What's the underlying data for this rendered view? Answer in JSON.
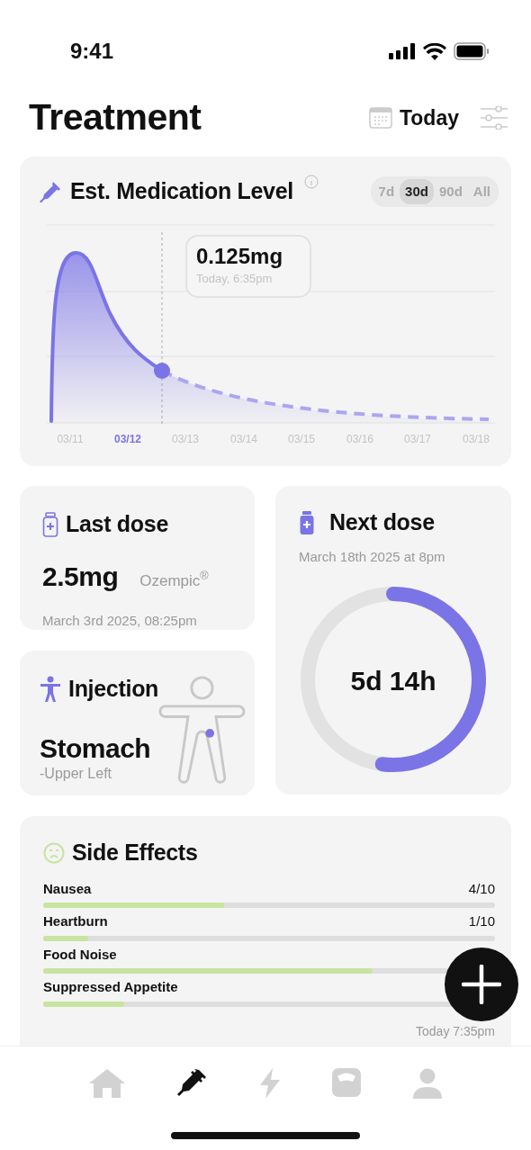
{
  "status_bar": {
    "time": "9:41"
  },
  "header": {
    "title": "Treatment",
    "date_button": "Today"
  },
  "medication_level": {
    "title": "Est. Medication Level",
    "ranges": [
      {
        "label": "7d",
        "selected": false
      },
      {
        "label": "30d",
        "selected": true
      },
      {
        "label": "90d",
        "selected": false
      },
      {
        "label": "All",
        "selected": false
      }
    ],
    "tooltip": {
      "value": "0.125mg",
      "time": "Today, 6:35pm"
    },
    "dates": [
      {
        "label": "03/11",
        "selected": false
      },
      {
        "label": "03/12",
        "selected": true
      },
      {
        "label": "03/13",
        "selected": false
      },
      {
        "label": "03/14",
        "selected": false
      },
      {
        "label": "03/15",
        "selected": false
      },
      {
        "label": "03/16",
        "selected": false
      },
      {
        "label": "03/17",
        "selected": false
      },
      {
        "label": "03/18",
        "selected": false
      }
    ]
  },
  "last_dose": {
    "title": "Last dose",
    "amount": "2.5mg",
    "brand": "Ozempic$^{®}$",
    "time": "March 3rd 2025, 08:25pm"
  },
  "next_dose": {
    "title": "Next dose",
    "time": "March 18th 2025 at 8pm",
    "countdown": "5d 14h",
    "level": 0.52
  },
  "injection": {
    "title": "Injection",
    "site": "Stomach",
    "detail": "-Upper Left"
  },
  "side_effects": {
    "title": "Side Effects",
    "time": "Today 7:35pm",
    "items": [
      {
        "name": "Nausea",
        "reading": "4/10",
        "level": 0.4
      },
      {
        "name": "Heartburn",
        "reading": "1/10",
        "level": 0.1
      },
      {
        "name": "Food Noise",
        "level": 0.73
      },
      {
        "name": "Suppressed Appetite",
        "level": 0.18
      }
    ]
  },
  "tab_bar": [
    {
      "kind": "home",
      "selected": false
    },
    {
      "kind": "syringe",
      "selected": true
    },
    {
      "kind": "bolt",
      "selected": false
    },
    {
      "kind": "scale",
      "selected": false
    },
    {
      "kind": "profile",
      "selected": false
    }
  ]
}
